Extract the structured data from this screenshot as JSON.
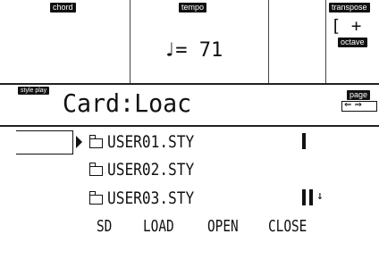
{
  "header": {
    "chord_tag": "chord",
    "tempo_tag": "tempo",
    "tempo_value": "♩= 71",
    "transpose_tag": "transpose",
    "transpose_value": "[ +",
    "octave_tag": "octave",
    "style_play_tag": "style play",
    "page_title": "Card:Loac",
    "page_tag": "page",
    "page_value": "⇐ ⇒"
  },
  "file_list": {
    "items": [
      {
        "name": "USER01.STY"
      },
      {
        "name": "USER02.STY"
      },
      {
        "name": "USER03.STY"
      }
    ],
    "scroll_glyph": "↓"
  },
  "softkeys": {
    "sd": "SD",
    "load": "LOAD",
    "open": "OPEN",
    "close": "CLOSE"
  }
}
